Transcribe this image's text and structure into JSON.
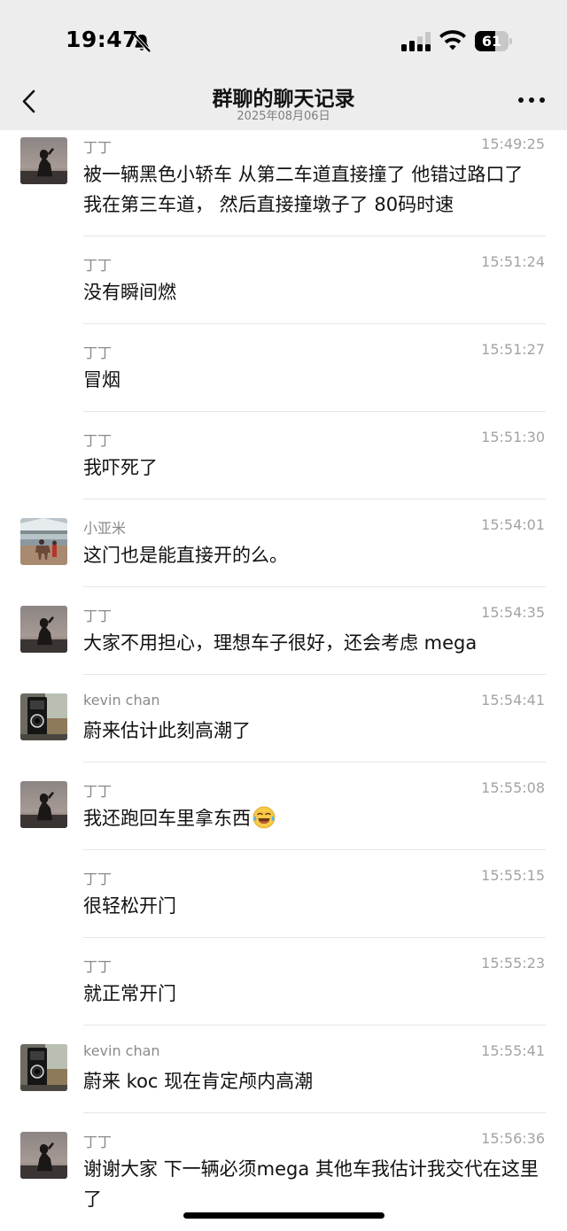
{
  "status_bar": {
    "time": "19:47",
    "battery": "61",
    "battery_level": 0.61,
    "icons": [
      "bell-off-icon",
      "signal-icon",
      "wifi-icon",
      "battery-icon"
    ]
  },
  "header": {
    "title": "群聊的聊天记录",
    "subtitle": "2025年08月06日",
    "back_icon": "chevron-left-icon",
    "more_icon": "more-horizontal-icon"
  },
  "messages": [
    {
      "sender": "丁丁",
      "time": "15:49:25",
      "text": "被一辆黑色小轿车 从第二车道直接撞了  他错过路口了 我在第三车道， 然后直接撞墩子了 80码时速",
      "avatar": "dingding"
    },
    {
      "sender": "丁丁",
      "time": "15:51:24",
      "text": "没有瞬间燃",
      "avatar": ""
    },
    {
      "sender": "丁丁",
      "time": "15:51:27",
      "text": "冒烟",
      "avatar": ""
    },
    {
      "sender": "丁丁",
      "time": "15:51:30",
      "text": "我吓死了",
      "avatar": ""
    },
    {
      "sender": "小亚米",
      "time": "15:54:01",
      "text": "这门也是能直接开的么。",
      "avatar": "xiaoyami"
    },
    {
      "sender": "丁丁",
      "time": "15:54:35",
      "text": "大家不用担心，理想车子很好，还会考虑 mega",
      "avatar": "dingding"
    },
    {
      "sender": "kevin chan",
      "time": "15:54:41",
      "text": "蔚来估计此刻高潮了",
      "avatar": "kevin"
    },
    {
      "sender": "丁丁",
      "time": "15:55:08",
      "text": "我还跑回车里拿东西",
      "avatar": "dingding",
      "emoji": "laughing-crying-emoji"
    },
    {
      "sender": "丁丁",
      "time": "15:55:15",
      "text": "很轻松开门",
      "avatar": ""
    },
    {
      "sender": "丁丁",
      "time": "15:55:23",
      "text": "就正常开门",
      "avatar": ""
    },
    {
      "sender": "kevin chan",
      "time": "15:55:41",
      "text": "蔚来 koc 现在肯定颅内高潮",
      "avatar": "kevin"
    },
    {
      "sender": "丁丁",
      "time": "15:56:36",
      "text": "谢谢大家   下一辆必须mega  其他车我估计我交代在这里了",
      "avatar": "dingding"
    }
  ]
}
